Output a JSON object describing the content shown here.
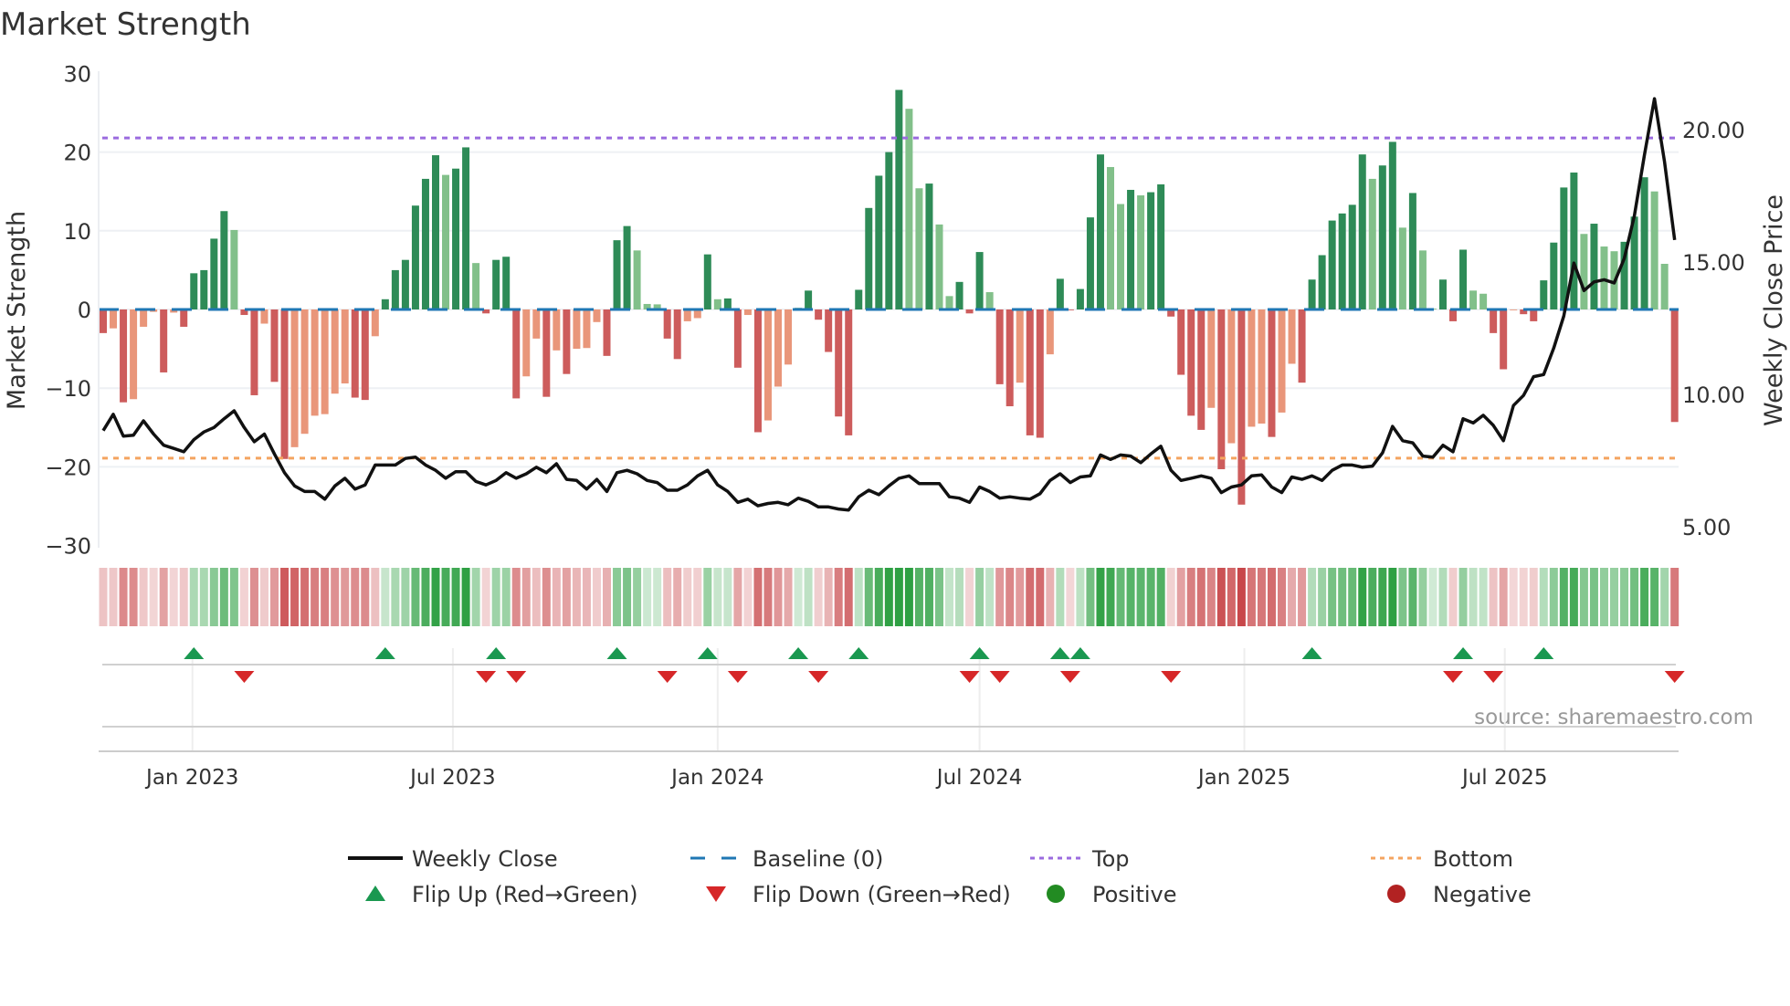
{
  "chart_data": {
    "type": "bar",
    "title": "Market Strength",
    "ylabel": "Market Strength",
    "y2label": "Weekly Close Price",
    "ylim": [
      -30,
      30
    ],
    "y2lim": [
      5,
      22
    ],
    "yticks": [
      "30",
      "20",
      "10",
      "0",
      "−10",
      "−20",
      "−30"
    ],
    "ytick_values": [
      30,
      20,
      10,
      0,
      -10,
      -20,
      -30
    ],
    "y2ticks": [
      "20.00",
      "15.00",
      "10.00",
      "5.00"
    ],
    "y2tick_values": [
      20,
      15,
      10,
      5
    ],
    "x_start": "2022-10-31",
    "x_step_days": 7,
    "xticks": [
      {
        "label": "Jan 2023",
        "date": "2023-01-01"
      },
      {
        "label": "Jul 2023",
        "date": "2023-07-01"
      },
      {
        "label": "Jan 2024",
        "date": "2024-01-01"
      },
      {
        "label": "Jul 2024",
        "date": "2024-07-01"
      },
      {
        "label": "Jan 2025",
        "date": "2025-01-01"
      },
      {
        "label": "Jul 2025",
        "date": "2025-07-01"
      }
    ],
    "top_level": 21.8,
    "bottom_level": -18.9,
    "grid": true,
    "legend_position": "bottom",
    "strength": [
      -3.0,
      -2.4,
      -11.8,
      -11.4,
      -2.2,
      -0.3,
      -8.0,
      -0.4,
      -2.2,
      4.6,
      5.0,
      9.0,
      12.5,
      10.1,
      -0.7,
      -10.9,
      -1.8,
      -9.2,
      -19.0,
      -17.5,
      -15.8,
      -13.5,
      -13.3,
      -10.7,
      -9.4,
      -11.2,
      -11.5,
      -3.4,
      1.3,
      5.0,
      6.3,
      13.2,
      16.6,
      19.6,
      17.1,
      17.9,
      20.6,
      5.9,
      -0.5,
      6.3,
      6.7,
      -11.3,
      -8.5,
      -3.7,
      -11.1,
      -5.2,
      -8.2,
      -5.0,
      -4.9,
      -1.6,
      -5.9,
      8.8,
      10.6,
      7.5,
      0.7,
      0.65,
      -3.7,
      -6.3,
      -1.5,
      -1.1,
      7.0,
      1.3,
      1.4,
      -7.4,
      -0.7,
      -15.6,
      -14.1,
      -9.8,
      -7.0,
      0.2,
      2.4,
      -1.3,
      -5.4,
      -13.6,
      -16.0,
      2.5,
      12.9,
      17.0,
      20.0,
      27.9,
      25.5,
      15.4,
      16.0,
      10.8,
      1.7,
      3.5,
      -0.5,
      7.3,
      2.2,
      -9.5,
      -12.3,
      -9.3,
      -16.0,
      -16.3,
      -5.7,
      3.9,
      -0.1,
      2.6,
      11.7,
      19.7,
      18.1,
      13.4,
      15.2,
      14.5,
      14.9,
      15.9,
      -0.9,
      -8.3,
      -13.5,
      -15.3,
      -12.5,
      -20.3,
      -17.0,
      -24.8,
      -14.9,
      -14.5,
      -16.2,
      -13.1,
      -6.9,
      -9.3,
      3.8,
      6.9,
      11.3,
      12.2,
      13.3,
      19.7,
      16.6,
      18.3,
      21.3,
      10.4,
      14.8,
      7.5,
      0.1,
      3.8,
      -1.5,
      7.6,
      2.4,
      2.0,
      -3.0,
      -7.6,
      -0.1,
      -0.6,
      -1.5,
      3.7,
      8.5,
      15.5,
      17.4,
      9.6,
      10.9,
      8.0,
      7.4,
      8.6,
      11.8,
      16.8,
      15.0,
      5.8,
      -14.3
    ],
    "weekly_close": [
      8.63,
      9.25,
      8.42,
      8.46,
      9.0,
      8.5,
      8.08,
      7.96,
      7.83,
      8.29,
      8.58,
      8.75,
      9.08,
      9.38,
      8.75,
      8.21,
      8.5,
      7.75,
      7.04,
      6.54,
      6.33,
      6.33,
      6.04,
      6.54,
      6.83,
      6.42,
      6.58,
      7.33,
      7.33,
      7.33,
      7.58,
      7.63,
      7.33,
      7.13,
      6.83,
      7.08,
      7.08,
      6.71,
      6.58,
      6.75,
      7.04,
      6.83,
      7.0,
      7.25,
      7.04,
      7.38,
      6.79,
      6.75,
      6.42,
      6.79,
      6.33,
      7.04,
      7.13,
      7.0,
      6.75,
      6.67,
      6.38,
      6.38,
      6.58,
      6.92,
      7.13,
      6.58,
      6.33,
      5.92,
      6.04,
      5.79,
      5.88,
      5.92,
      5.83,
      6.08,
      5.96,
      5.75,
      5.75,
      5.67,
      5.63,
      6.13,
      6.38,
      6.21,
      6.54,
      6.83,
      6.92,
      6.63,
      6.63,
      6.63,
      6.13,
      6.08,
      5.92,
      6.5,
      6.33,
      6.08,
      6.13,
      6.08,
      6.04,
      6.25,
      6.75,
      7.0,
      6.67,
      6.88,
      6.92,
      7.71,
      7.54,
      7.71,
      7.67,
      7.42,
      7.75,
      8.04,
      7.13,
      6.75,
      6.83,
      6.92,
      6.83,
      6.29,
      6.5,
      6.58,
      6.92,
      6.96,
      6.5,
      6.29,
      6.88,
      6.79,
      6.92,
      6.75,
      7.13,
      7.33,
      7.33,
      7.25,
      7.29,
      7.79,
      8.79,
      8.25,
      8.17,
      7.67,
      7.63,
      8.08,
      7.83,
      9.08,
      8.92,
      9.21,
      8.83,
      8.25,
      9.58,
      9.96,
      10.67,
      10.75,
      11.75,
      12.96,
      14.96,
      13.92,
      14.25,
      14.33,
      14.21,
      15.13,
      16.75,
      19.04,
      21.17,
      18.79,
      15.83
    ],
    "legend": [
      {
        "label": "Weekly Close",
        "symbol": "line",
        "color": "#111111"
      },
      {
        "label": "Baseline (0)",
        "symbol": "dash",
        "color": "#1f77b4"
      },
      {
        "label": "Top",
        "symbol": "dot",
        "color": "#9b6bdf"
      },
      {
        "label": "Bottom",
        "symbol": "dot",
        "color": "#f4a460"
      },
      {
        "label": "Flip Up (Red→Green)",
        "symbol": "triangle-up",
        "color": "#1a9850"
      },
      {
        "label": "Flip Down (Green→Red)",
        "symbol": "triangle-down",
        "color": "#d62728"
      },
      {
        "label": "Positive",
        "symbol": "circle",
        "color": "#228b22"
      },
      {
        "label": "Negative",
        "symbol": "circle",
        "color": "#b22222"
      }
    ],
    "colors": {
      "pos_rising": "#2e8b57",
      "pos_falling": "#82c08a",
      "neg_falling": "#cd5c5c",
      "neg_rising": "#e9967a",
      "flip_up": "#1a9850",
      "flip_down": "#d62728",
      "baseline": "#1f77b4",
      "top": "#9b6bdf",
      "bottom": "#f4a460"
    }
  },
  "source": "source: sharemaestro.com"
}
